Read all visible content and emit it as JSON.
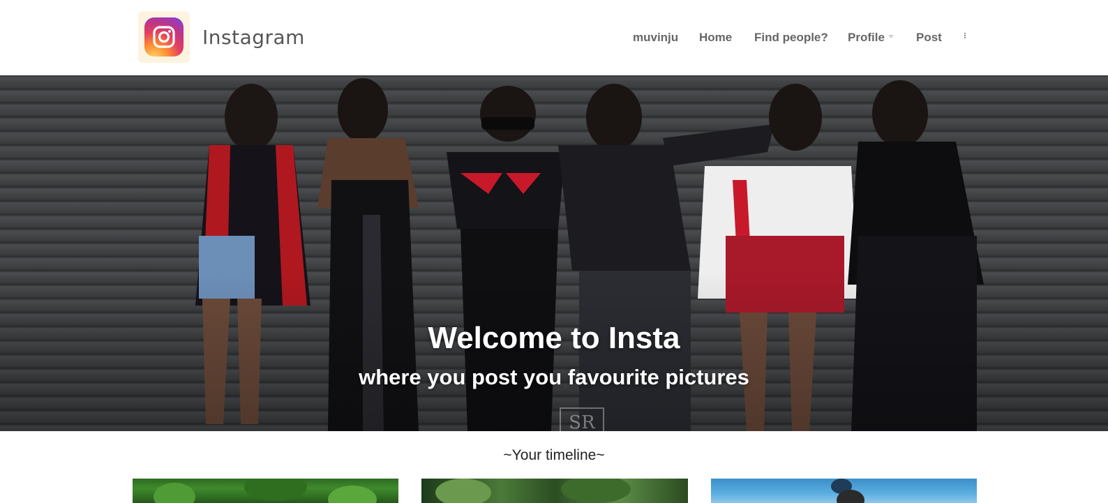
{
  "brand": {
    "name": "Instagram",
    "logo_icon": "instagram-logo-icon"
  },
  "nav": {
    "items": [
      {
        "label": "muvinju"
      },
      {
        "label": "Home"
      },
      {
        "label": "Find people?"
      },
      {
        "label": "Profile",
        "has_dropdown": true
      },
      {
        "label": "Post"
      }
    ],
    "more_icon": "vertical-ellipsis-icon"
  },
  "hero": {
    "title": "Welcome to Insta",
    "subtitle": "where you post you favourite pictures",
    "watermark": "SR"
  },
  "timeline": {
    "title": "~Your timeline~",
    "posts": [
      {
        "image": "green-foliage-photo"
      },
      {
        "image": "forest-trees-photo"
      },
      {
        "image": "blue-sky-cyclist-photo"
      }
    ]
  },
  "colors": {
    "nav_text": "#666666",
    "brand_text": "#555555",
    "hero_text": "#ffffff",
    "instagram_gradient": [
      "#fdd567",
      "#fd8d32",
      "#e4405f",
      "#c13584",
      "#7b3fe4"
    ]
  }
}
